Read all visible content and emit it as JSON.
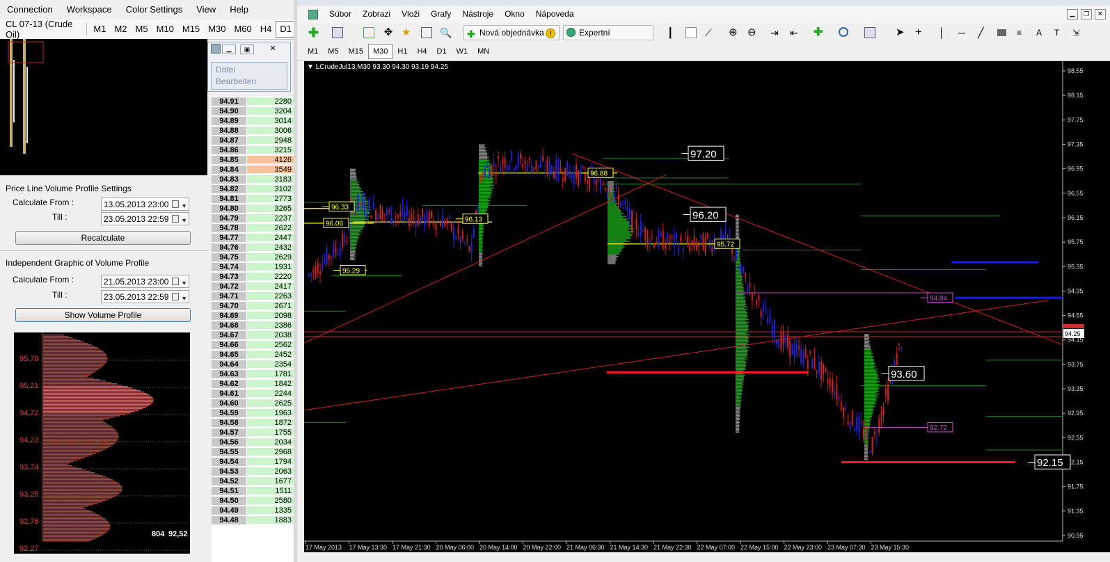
{
  "left_app": {
    "menu": [
      "Connection",
      "Workspace",
      "Color Settings",
      "View",
      "Help"
    ],
    "symbol": "CL 07-13 (Crude Oil)",
    "timeframes": [
      "M1",
      "M2",
      "M5",
      "M10",
      "M15",
      "M30",
      "M60",
      "H4",
      "D1"
    ],
    "active_timeframe": "D1",
    "price_line_settings": {
      "title": "Price Line Volume Profile Settings",
      "calc_from_label": "Calculate From :",
      "calc_from_value": "13.05.2013 23:00",
      "till_label": "Till :",
      "till_value": "23.05.2013 22:59",
      "button": "Recalculate"
    },
    "independent_graphic": {
      "title": "Independent Graphic of Volume Profile",
      "calc_from_label": "Calculate From :",
      "calc_from_value": "21.05.2013 23:00",
      "till_label": "Till :",
      "till_value": "23.05.2013 22:59",
      "button": "Show Volume Profile"
    },
    "vp_chart": {
      "levels": [
        "95,70",
        "95,21",
        "94,72",
        "94,23",
        "93,74",
        "93,25",
        "92,76",
        "92,27"
      ],
      "footer_left": "804",
      "footer_right": "92,52"
    },
    "popup_menu": [
      "Datei",
      "Bearbeiten"
    ]
  },
  "ladder": [
    {
      "price": "94.91",
      "vol": "2280"
    },
    {
      "price": "94.90",
      "vol": "3204"
    },
    {
      "price": "94.89",
      "vol": "3014"
    },
    {
      "price": "94.88",
      "vol": "3006"
    },
    {
      "price": "94.87",
      "vol": "2948"
    },
    {
      "price": "94.86",
      "vol": "3215"
    },
    {
      "price": "94.85",
      "vol": "4126",
      "hl": true
    },
    {
      "price": "94.84",
      "vol": "3549",
      "hl": true
    },
    {
      "price": "94.83",
      "vol": "3183"
    },
    {
      "price": "94.82",
      "vol": "3102"
    },
    {
      "price": "94.81",
      "vol": "2773"
    },
    {
      "price": "94.80",
      "vol": "3265"
    },
    {
      "price": "94.79",
      "vol": "2237"
    },
    {
      "price": "94.78",
      "vol": "2622"
    },
    {
      "price": "94.77",
      "vol": "2447"
    },
    {
      "price": "94.76",
      "vol": "2432"
    },
    {
      "price": "94.75",
      "vol": "2629"
    },
    {
      "price": "94.74",
      "vol": "1931"
    },
    {
      "price": "94.73",
      "vol": "2220"
    },
    {
      "price": "94.72",
      "vol": "2417"
    },
    {
      "price": "94.71",
      "vol": "2263"
    },
    {
      "price": "94.70",
      "vol": "2671"
    },
    {
      "price": "94.69",
      "vol": "2098"
    },
    {
      "price": "94.68",
      "vol": "2386"
    },
    {
      "price": "94.67",
      "vol": "2038"
    },
    {
      "price": "94.66",
      "vol": "2562"
    },
    {
      "price": "94.65",
      "vol": "2452"
    },
    {
      "price": "94.64",
      "vol": "2354"
    },
    {
      "price": "94.63",
      "vol": "1781"
    },
    {
      "price": "94.62",
      "vol": "1842"
    },
    {
      "price": "94.61",
      "vol": "2244"
    },
    {
      "price": "94.60",
      "vol": "2625"
    },
    {
      "price": "94.59",
      "vol": "1963"
    },
    {
      "price": "94.58",
      "vol": "1872"
    },
    {
      "price": "94.57",
      "vol": "1755"
    },
    {
      "price": "94.56",
      "vol": "2034"
    },
    {
      "price": "94.55",
      "vol": "2968"
    },
    {
      "price": "94.54",
      "vol": "1794"
    },
    {
      "price": "94.53",
      "vol": "2063"
    },
    {
      "price": "94.52",
      "vol": "1677"
    },
    {
      "price": "94.51",
      "vol": "1511"
    },
    {
      "price": "94.50",
      "vol": "2580"
    },
    {
      "price": "94.49",
      "vol": "1335"
    },
    {
      "price": "94.48",
      "vol": "1883"
    }
  ],
  "mt4": {
    "menu": [
      "Súbor",
      "Zobrazi",
      "Vloži",
      "Grafy",
      "Nástroje",
      "Okno",
      "Nápoveda"
    ],
    "new_order": "Nová objednávka",
    "expert_advisors": "Expertní poradcovia",
    "timeframes": [
      "M1",
      "M5",
      "M15",
      "M30",
      "H1",
      "H4",
      "D1",
      "W1",
      "MN"
    ],
    "active_timeframe": "M30",
    "chart_header": "LCrudeJul13,M30  93.30 94.30 93.19 94.25",
    "price_axis": [
      "98.55",
      "98.15",
      "97.75",
      "97.35",
      "96.95",
      "96.55",
      "96.15",
      "95.75",
      "95.35",
      "94.95",
      "94.55",
      "94.15",
      "93.75",
      "93.35",
      "92.95",
      "92.55",
      "92.15",
      "91.75",
      "91.35",
      "90.95"
    ],
    "current_price": "94.25",
    "time_axis": [
      "17 May 2013",
      "17 May 13:30",
      "17 May 21:30",
      "20 May 06:00",
      "20 May 14:00",
      "20 May 22:00",
      "21 May 06:30",
      "21 May 14:30",
      "21 May 22:30",
      "22 May 07:00",
      "22 May 15:00",
      "22 May 23:00",
      "23 May 07:30",
      "23 May 15:30"
    ],
    "labels_white": [
      "97.20",
      "96.20",
      "93.60",
      "92.15"
    ],
    "labels_yellow": [
      "96.88",
      "96.33",
      "96.06",
      "96.13",
      "95.29",
      "95.72"
    ],
    "labels_magenta": [
      "94.84",
      "92.72"
    ]
  },
  "colors": {
    "bull": "#2222dd",
    "bear": "#cc2222",
    "profile_green": "#1aa31a",
    "profile_gray": "#888888",
    "poc": "#ffff33"
  }
}
